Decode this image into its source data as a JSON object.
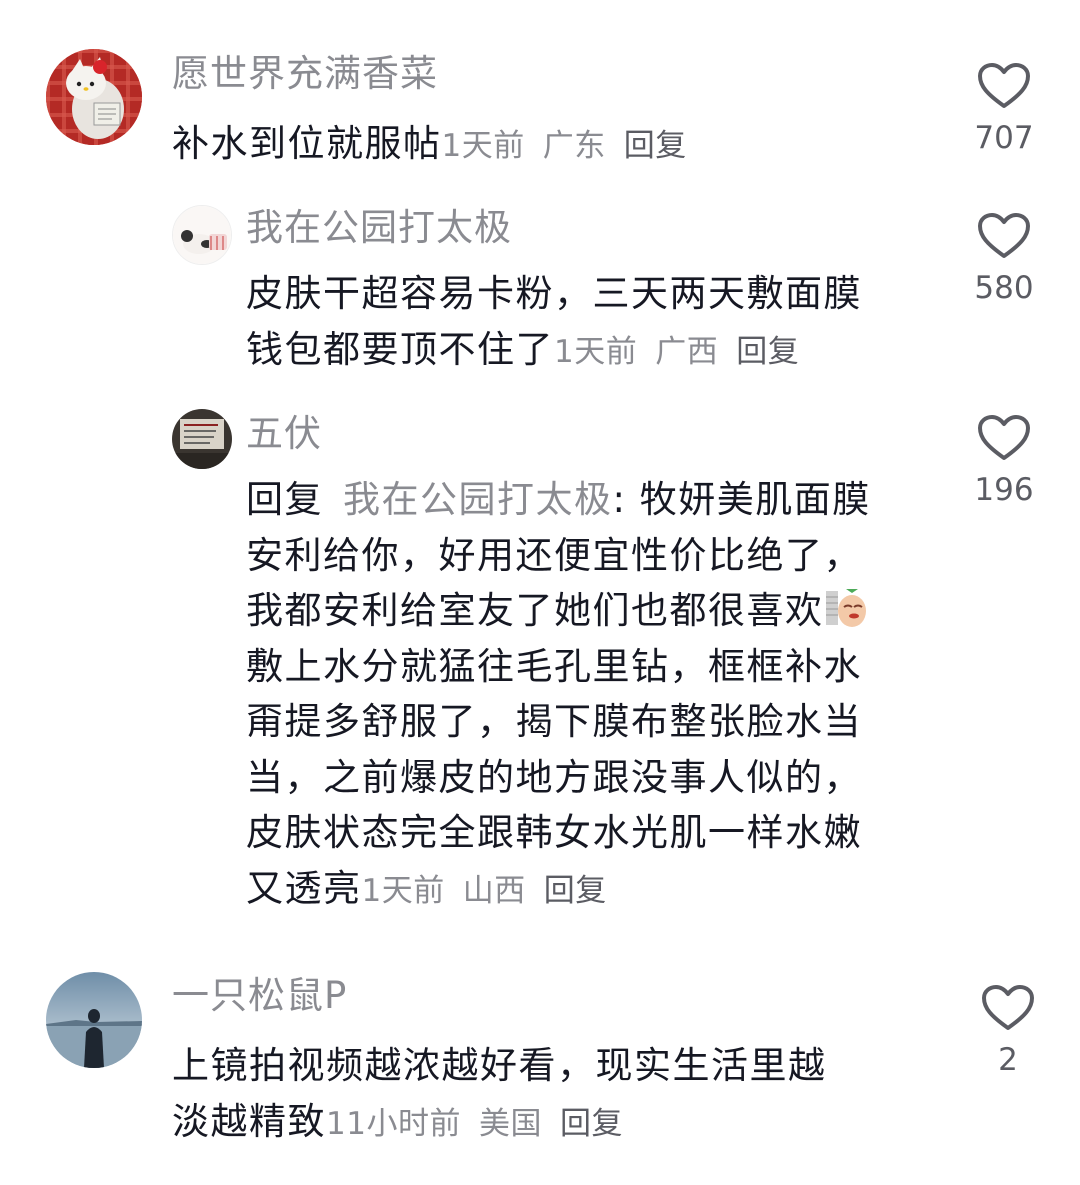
{
  "comments": [
    {
      "username": "愿世界充满香菜",
      "text": "补水到位就服帖",
      "time": "1天前",
      "location": "广东",
      "reply_label": "回复",
      "likes": "707",
      "avatar_icon": "hello-kitty-avatar"
    },
    {
      "username": "我在公园打太极",
      "text_line1": "皮肤干超容易卡粉，三天两天敷面膜",
      "text_line2": "钱包都要顶不住了",
      "time": "1天前",
      "location": "广西",
      "reply_label": "回复",
      "likes": "580",
      "avatar_icon": "panda-avatar"
    },
    {
      "username": "五伏",
      "reply_prefix": "回复",
      "reply_to": "我在公园打太极",
      "colon": ":",
      "lines": [
        " 牧妍美肌面膜",
        "安利给你，好用还便宜性价比绝了，",
        "我都安利给室友了她们也都很喜欢",
        "敷上水分就猛往毛孔里钻，框框补水",
        "甭提多舒服了，揭下膜布整张脸水当",
        "当，之前爆皮的地方跟没事人似的，",
        "皮肤状态完全跟韩女水光肌一样水嫩",
        "又透亮"
      ],
      "time": "1天前",
      "location": "山西",
      "reply_label": "回复",
      "likes": "196",
      "avatar_icon": "photo-avatar",
      "sticker_icon": "smirk-sticker-icon"
    },
    {
      "username": "一只松鼠P",
      "text_line1": "上镜拍视频越浓越好看，现实生活里越",
      "text_line2": "淡越精致",
      "time": "11小时前",
      "location": "美国",
      "reply_label": "回复",
      "likes": "2",
      "avatar_icon": "lake-silhouette-avatar"
    }
  ],
  "colors": {
    "text": "#161823",
    "meta": "#8a8b91",
    "reply": "#5b5c63",
    "heart_stroke": "#5b5c63"
  }
}
